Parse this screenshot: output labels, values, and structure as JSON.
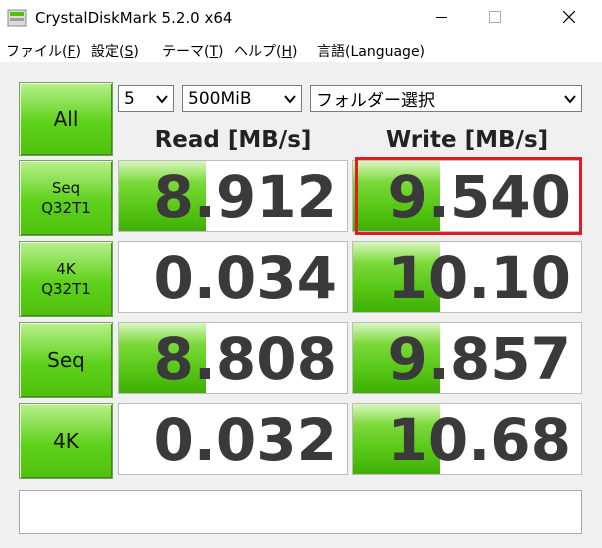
{
  "window": {
    "title": "CrystalDiskMark 5.2.0 x64"
  },
  "menu": [
    {
      "label": "ファイル(",
      "key": "F",
      "suffix": ")"
    },
    {
      "label": "設定(",
      "key": "S",
      "suffix": ")"
    },
    {
      "label": "テーマ(",
      "key": "T",
      "suffix": ")"
    },
    {
      "label": "ヘルプ(",
      "key": "H",
      "suffix": ")"
    },
    {
      "label": "言語(Language)",
      "key": "",
      "suffix": ""
    }
  ],
  "controls": {
    "all_label": "All",
    "count_value": "5",
    "size_value": "500MiB",
    "folder_value": "フォルダー選択"
  },
  "headers": {
    "read": "Read [MB/s]",
    "write": "Write [MB/s]"
  },
  "tests": [
    {
      "line1": "Seq",
      "line2": "Q32T1",
      "read": "8.912",
      "write": "9.540",
      "read_fill": 0.38,
      "write_fill": 0.38
    },
    {
      "line1": "4K",
      "line2": "Q32T1",
      "read": "0.034",
      "write": "10.10",
      "read_fill": 0.0,
      "write_fill": 0.38
    },
    {
      "line1": "Seq",
      "line2": "",
      "read": "8.808",
      "write": "9.857",
      "read_fill": 0.38,
      "write_fill": 0.38
    },
    {
      "line1": "4K",
      "line2": "",
      "read": "0.032",
      "write": "10.68",
      "read_fill": 0.0,
      "write_fill": 0.38
    }
  ],
  "comment": ""
}
